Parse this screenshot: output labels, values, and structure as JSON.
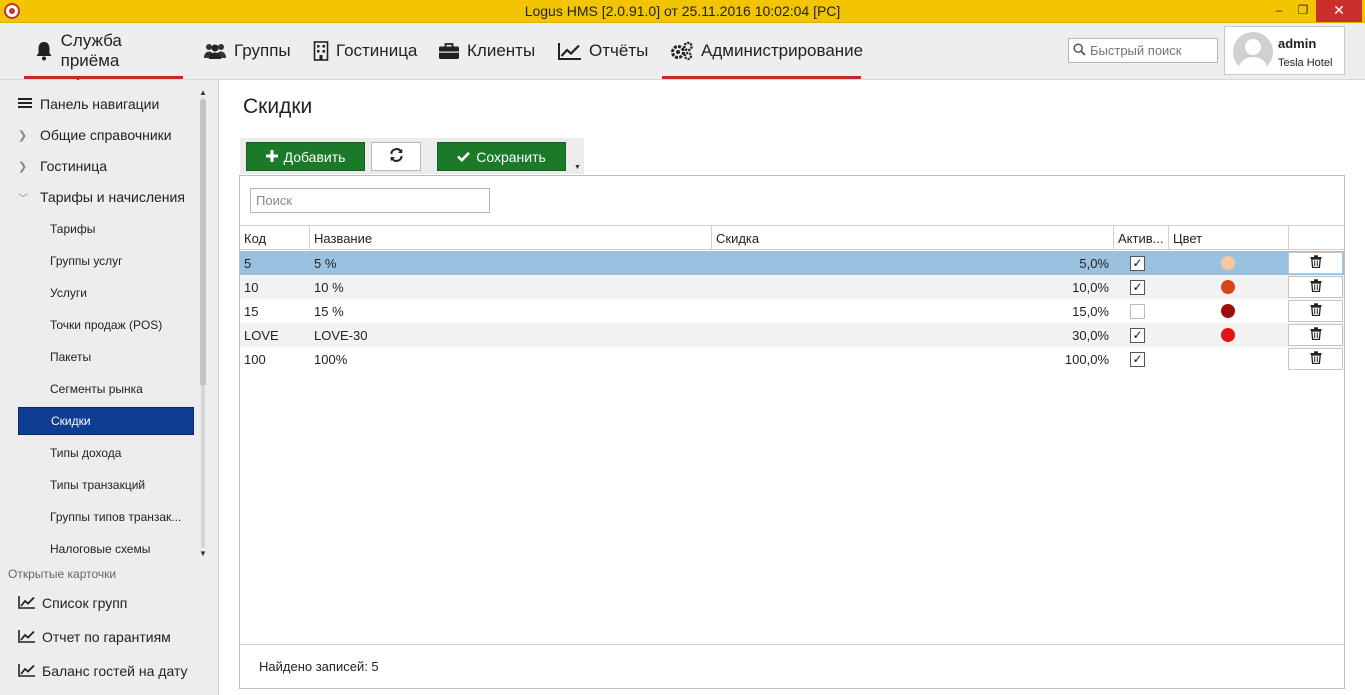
{
  "window": {
    "title": "Logus HMS [2.0.91.0] от 25.11.2016 10:02:04 [PC]",
    "min_glyph": "–",
    "max_glyph": "❐",
    "close_glyph": "✕"
  },
  "topnav": {
    "items": [
      {
        "label": "Служба приёма",
        "icon": "bell-icon"
      },
      {
        "label": "Группы",
        "icon": "users-icon"
      },
      {
        "label": "Гостиница",
        "icon": "building-icon"
      },
      {
        "label": "Клиенты",
        "icon": "briefcase-icon"
      },
      {
        "label": "Отчёты",
        "icon": "chart-line-icon"
      },
      {
        "label": "Администрирование",
        "icon": "gears-icon"
      }
    ],
    "search_placeholder": "Быстрый поиск",
    "user": {
      "name": "admin",
      "hotel": "Tesla Hotel"
    },
    "accent_color": "#c62828"
  },
  "sidebar": {
    "header": "Панель навигации",
    "sections": [
      {
        "label": "Общие справочники",
        "expanded": false
      },
      {
        "label": "Гостиница",
        "expanded": false
      },
      {
        "label": "Тарифы и начисления",
        "expanded": true
      }
    ],
    "sub_items": [
      {
        "label": "Тарифы",
        "active": false
      },
      {
        "label": "Группы услуг",
        "active": false
      },
      {
        "label": "Услуги",
        "active": false
      },
      {
        "label": "Точки продаж (POS)",
        "active": false
      },
      {
        "label": "Пакеты",
        "active": false
      },
      {
        "label": "Сегменты рынка",
        "active": false
      },
      {
        "label": "Скидки",
        "active": true
      },
      {
        "label": "Типы дохода",
        "active": false
      },
      {
        "label": "Типы транзакций",
        "active": false
      },
      {
        "label": "Группы типов транзак...",
        "active": false
      },
      {
        "label": "Налоговые схемы",
        "active": false
      }
    ],
    "open_cards_title": "Открытые карточки",
    "open_cards": [
      {
        "label": "Список групп",
        "icon": "chart-line-icon"
      },
      {
        "label": "Отчет по гарантиям",
        "icon": "chart-line-icon"
      },
      {
        "label": "Баланс гостей на дату",
        "icon": "chart-line-icon"
      }
    ],
    "active_color": "#0f3d91"
  },
  "main": {
    "title": "Скидки",
    "toolbar": {
      "add_label": "Добавить",
      "save_label": "Сохранить"
    },
    "search_placeholder": "Поиск",
    "columns": [
      "Код",
      "Название",
      "Скидка",
      "Актив...",
      "Цвет"
    ],
    "rows": [
      {
        "code": "5",
        "name": "5 %",
        "discount": "5,0%",
        "active": true,
        "color": "#f5c99a",
        "selected": true
      },
      {
        "code": "10",
        "name": "10 %",
        "discount": "10,0%",
        "active": true,
        "color": "#d9441a",
        "selected": false
      },
      {
        "code": "15",
        "name": "15 %",
        "discount": "15,0%",
        "active": false,
        "color": "#a00c0c",
        "selected": false
      },
      {
        "code": "LOVE",
        "name": "LOVE-30",
        "discount": "30,0%",
        "active": true,
        "color": "#e31414",
        "selected": false
      },
      {
        "code": "100",
        "name": "100%",
        "discount": "100,0%",
        "active": true,
        "color": "",
        "selected": false
      }
    ],
    "footer": "Найдено записей: 5",
    "button_color": "#1a7a2a",
    "selected_row_color": "#9bc1e0"
  }
}
